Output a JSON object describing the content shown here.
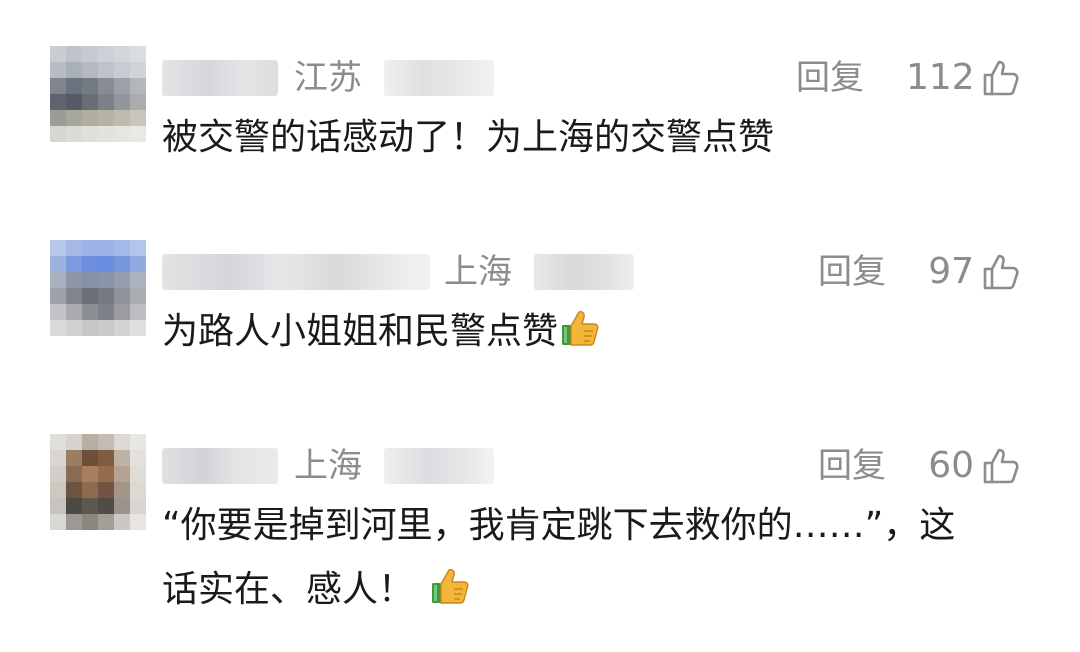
{
  "comments": [
    {
      "location": "江苏",
      "reply_label": "回复",
      "likes": "112",
      "text": "被交警的话感动了！为上海的交警点赞",
      "has_emoji": false
    },
    {
      "location": "上海",
      "reply_label": "回复",
      "likes": "97",
      "text": "为路人小姐姐和民警点赞",
      "has_emoji": true
    },
    {
      "location": "上海",
      "reply_label": "回复",
      "likes": "60",
      "text_line1": "“你要是掉到河里，我肯定跳下去救你的……”，这",
      "text_line2": "话实在、感人！",
      "has_emoji": true
    }
  ],
  "icons": {
    "like": "thumbs-up-outline-icon",
    "emoji": "thumbs-up-emoji-icon"
  },
  "colors": {
    "text": "#1a1a1a",
    "meta": "#8c8c8c",
    "background": "#ffffff"
  }
}
